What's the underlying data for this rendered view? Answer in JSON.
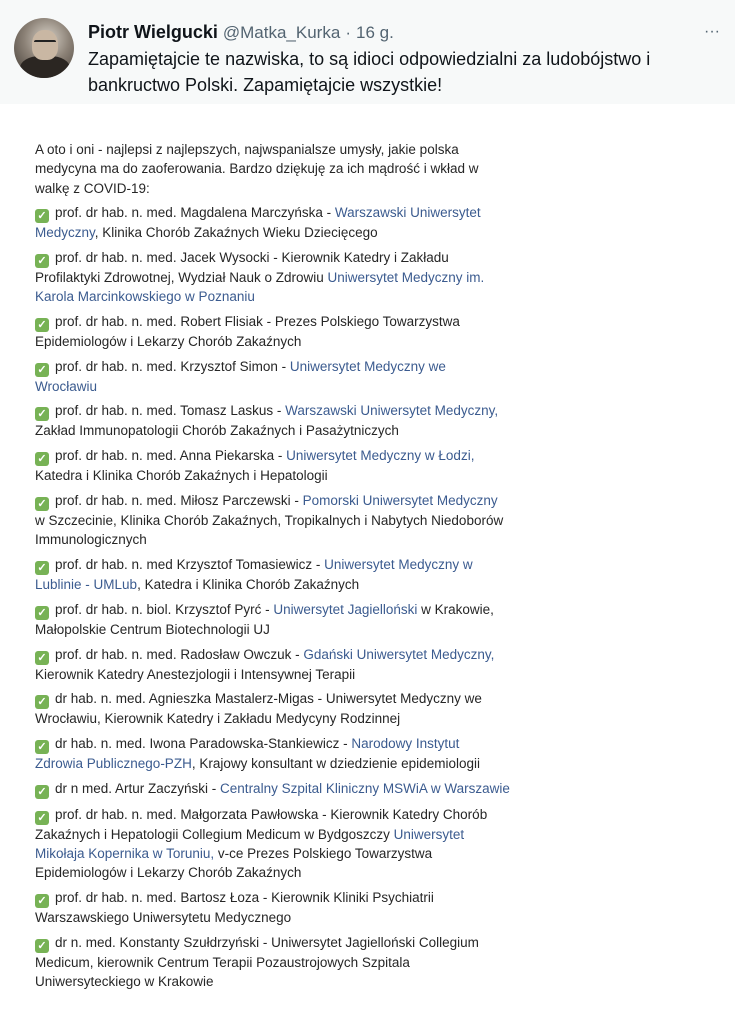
{
  "header": {
    "display_name": "Piotr Wielgucki",
    "handle": "@Matka_Kurka",
    "separator": "·",
    "time": "16 g.",
    "more_icon": "···",
    "text": "Zapamiętajcie te nazwiska, to są idioci odpowiedzialni za ludobójstwo i bankructwo Polski. Zapamiętajcie wszystkie!"
  },
  "post": {
    "intro": "A oto i oni - najlepsi z najlepszych, najwspanialsze umysły, jakie polska medycyna ma do zaoferowania. Bardzo dziękuję za ich mądrość i wkład w walkę z COVID-19:",
    "check_icon": "✓",
    "entries": [
      {
        "pre": "prof. dr hab. n. med. Magdalena Marczyńska - ",
        "link": "Warszawski Uniwersytet Medyczny",
        "post": ", Klinika Chorób Zakaźnych Wieku Dziecięcego"
      },
      {
        "pre": "prof. dr hab. n. med. Jacek Wysocki - Kierownik Katedry i Zakładu Profilaktyki Zdrowotnej, Wydział Nauk o Zdrowiu ",
        "link": "Uniwersytet Medyczny im. Karola Marcinkowskiego w Poznaniu",
        "post": ""
      },
      {
        "pre": "prof. dr hab. n. med. Robert Flisiak - Prezes Polskiego Towarzystwa Epidemiologów i Lekarzy Chorób Zakaźnych",
        "link": "",
        "post": ""
      },
      {
        "pre": "prof. dr hab. n. med. Krzysztof Simon - ",
        "link": "Uniwersytet Medyczny we Wrocławiu",
        "post": ""
      },
      {
        "pre": "prof. dr hab. n. med. Tomasz Laskus - ",
        "link": "Warszawski Uniwersytet Medyczny,",
        "post": " Zakład Immunopatologii Chorób Zakaźnych i Pasażytniczych"
      },
      {
        "pre": "prof. dr hab. n. med. Anna Piekarska - ",
        "link": "Uniwersytet Medyczny w Łodzi,",
        "post": " Katedra i Klinika Chorób Zakaźnych i Hepatologii"
      },
      {
        "pre": "prof. dr hab. n. med. Miłosz Parczewski - ",
        "link": "Pomorski Uniwersytet Medyczny",
        "post": " w Szczecinie, Klinika Chorób Zakaźnych, Tropikalnych i Nabytych Niedoborów Immunologicznych"
      },
      {
        "pre": "prof. dr hab. n. med Krzysztof Tomasiewicz - ",
        "link": "Uniwersytet Medyczny w Lublinie - UMLub",
        "post": ", Katedra i Klinika Chorób Zakaźnych"
      },
      {
        "pre": "prof. dr hab. n. biol. Krzysztof Pyrć - ",
        "link": "Uniwersytet Jagielloński",
        "post": " w Krakowie, Małopolskie Centrum Biotechnologii UJ"
      },
      {
        "pre": "prof. dr hab. n. med. Radosław Owczuk - ",
        "link": "Gdański Uniwersytet Medyczny,",
        "post": " Kierownik Katedry Anestezjologii i Intensywnej Terapii"
      },
      {
        "pre": "dr hab. n. med. Agnieszka Mastalerz-Migas - Uniwersytet Medyczny we Wrocławiu, Kierownik Katedry i Zakładu Medycyny Rodzinnej",
        "link": "",
        "post": ""
      },
      {
        "pre": "dr hab. n. med. Iwona Paradowska-Stankiewicz - ",
        "link": "Narodowy Instytut Zdrowia Publicznego-PZH",
        "post": ", Krajowy konsultant w dziedzienie epidemiologii"
      },
      {
        "pre": "dr n med. Artur Zaczyński - ",
        "link": "Centralny Szpital Kliniczny MSWiA w Warszawie",
        "post": ""
      },
      {
        "pre": "prof. dr hab. n. med. Małgorzata Pawłowska - Kierownik Katedry Chorób Zakaźnych i Hepatologii Collegium Medicum w Bydgoszczy ",
        "link": "Uniwersytet Mikołaja Kopernika w Toruniu,",
        "post": " v-ce Prezes Polskiego Towarzystwa Epidemiologów i Lekarzy Chorób Zakaźnych"
      },
      {
        "pre": "prof. dr hab. n. med. Bartosz Łoza - Kierownik Kliniki Psychiatrii Warszawskiego Uniwersytetu Medycznego",
        "link": "",
        "post": ""
      },
      {
        "pre": "dr n. med. Konstanty Szułdrzyński - Uniwersytet Jagielloński Collegium Medicum, kierownik Centrum Terapii Pozaustrojowych Szpitala Uniwersyteckiego w Krakowie",
        "link": "",
        "post": ""
      }
    ]
  }
}
